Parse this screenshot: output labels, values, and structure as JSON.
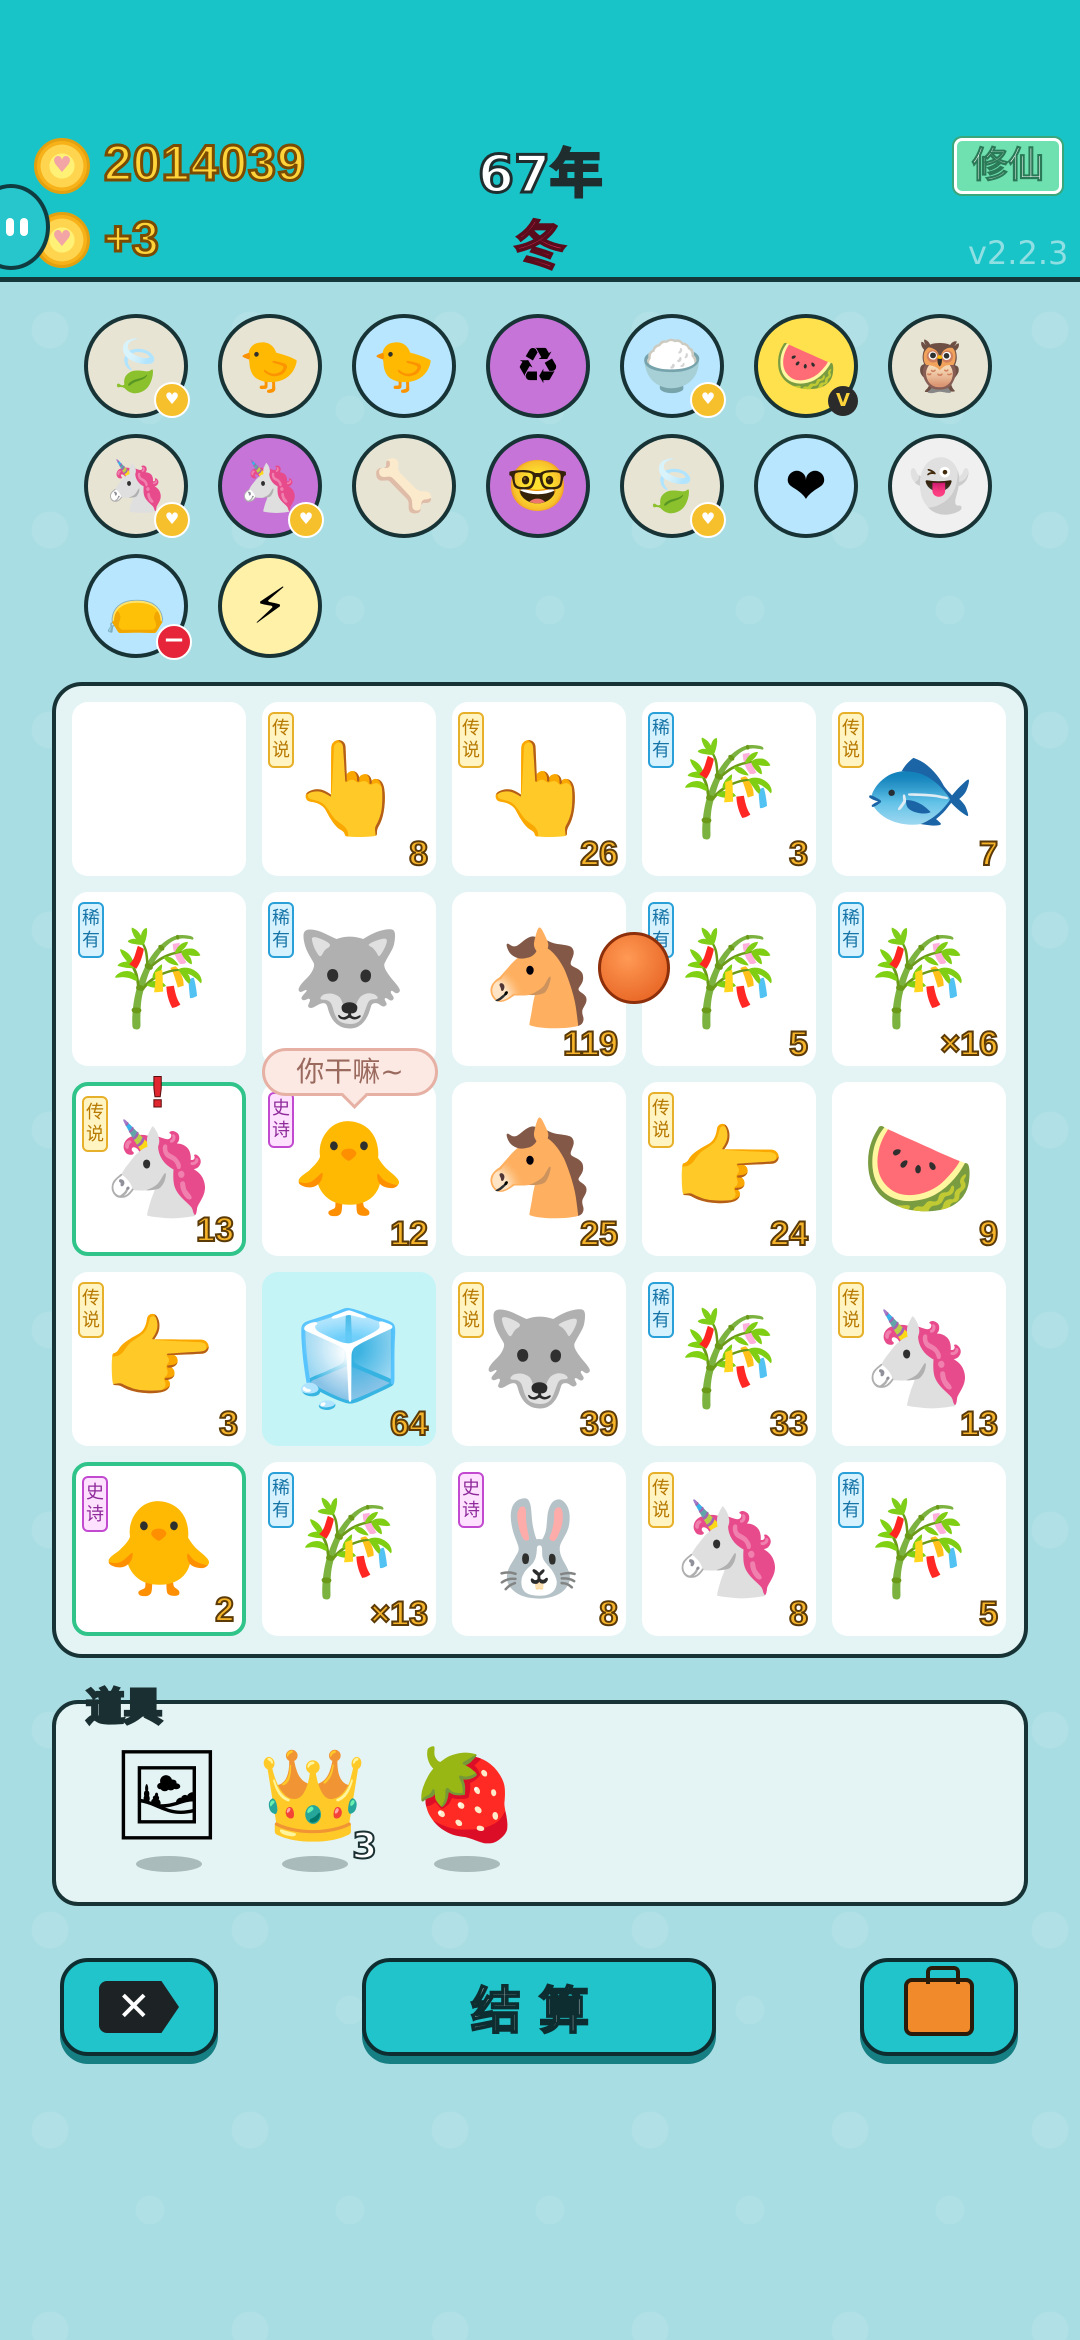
{
  "header": {
    "coins": "2014039",
    "coin_gain": "+3",
    "year": "67年",
    "season": "冬",
    "xiuxian_label": "修仙",
    "version": "v2.2.3"
  },
  "status_icons": [
    {
      "name": "leaf-icon",
      "glyph": "🍃",
      "bg": "#e7e4d4",
      "badge": "heart"
    },
    {
      "name": "chick-egg-icon",
      "glyph": "🐤",
      "bg": "#e7e4d4",
      "badge": ""
    },
    {
      "name": "chick-egg-icon-2",
      "glyph": "🐤",
      "bg": "#b8e6ff",
      "badge": ""
    },
    {
      "name": "recycle-icon",
      "glyph": "♻",
      "bg": "#c774d8",
      "badge": ""
    },
    {
      "name": "rice-bowl-icon",
      "glyph": "🍚",
      "bg": "#b8e6ff",
      "badge": "heart"
    },
    {
      "name": "fruit-basket-icon",
      "glyph": "🍉",
      "bg": "#ffe14d",
      "badge": "v"
    },
    {
      "name": "owl-icon",
      "glyph": "🦉",
      "bg": "#e7e4d4",
      "badge": ""
    },
    {
      "name": "unicorns-icon",
      "glyph": "🦄",
      "bg": "#e7e4d4",
      "badge": "heart"
    },
    {
      "name": "unicorns-icon-2",
      "glyph": "🦄",
      "bg": "#c774d8",
      "badge": "heart"
    },
    {
      "name": "dog-bowl-icon",
      "glyph": "🦴",
      "bg": "#e7e4d4",
      "badge": ""
    },
    {
      "name": "math-head-icon",
      "glyph": "🤓",
      "bg": "#c774d8",
      "badge": ""
    },
    {
      "name": "leaf-icon-2",
      "glyph": "🍃",
      "bg": "#e7e4d4",
      "badge": "heart"
    },
    {
      "name": "heart-potion-icon",
      "glyph": "❤",
      "bg": "#b8e6ff",
      "badge": ""
    },
    {
      "name": "ghost-icon",
      "glyph": "👻",
      "bg": "#f0f0f0",
      "badge": ""
    },
    {
      "name": "trash-bag-icon",
      "glyph": "👝",
      "bg": "#b8e6ff",
      "badge": "minus"
    },
    {
      "name": "lightning-icon",
      "glyph": "⚡",
      "bg": "#fff1a8",
      "badge": ""
    }
  ],
  "tiles": [
    {
      "name": "empty",
      "glyph": "",
      "tag": "",
      "count": ""
    },
    {
      "name": "finger",
      "glyph": "👆",
      "tag": "传说",
      "tagtype": "legend",
      "count": "8"
    },
    {
      "name": "finger",
      "glyph": "👆",
      "tag": "传说",
      "tagtype": "legend",
      "count": "26"
    },
    {
      "name": "bamboo",
      "glyph": "🎋",
      "tag": "稀有",
      "tagtype": "rare",
      "count": "3"
    },
    {
      "name": "koi",
      "glyph": "🐟",
      "tag": "传说",
      "tagtype": "legend",
      "count": "7"
    },
    {
      "name": "bamboo",
      "glyph": "🎋",
      "tag": "稀有",
      "tagtype": "rare",
      "count": ""
    },
    {
      "name": "husky",
      "glyph": "🐺",
      "tag": "稀有",
      "tagtype": "rare",
      "count": ""
    },
    {
      "name": "horse",
      "glyph": "🐴",
      "tag": "",
      "count": "119"
    },
    {
      "name": "bamboo",
      "glyph": "🎋",
      "tag": "稀有",
      "tagtype": "rare",
      "count": "5"
    },
    {
      "name": "bamboo",
      "glyph": "🎋",
      "tag": "稀有",
      "tagtype": "rare",
      "count": "×16"
    },
    {
      "name": "unicorn",
      "glyph": "🦄",
      "tag": "传说",
      "tagtype": "legend",
      "count": "13",
      "sel": true
    },
    {
      "name": "grandpa-bird",
      "glyph": "🐥",
      "tag": "史诗",
      "tagtype": "epic",
      "count": "12"
    },
    {
      "name": "horse",
      "glyph": "🐴",
      "tag": "",
      "count": "25"
    },
    {
      "name": "finger-point",
      "glyph": "👉",
      "tag": "传说",
      "tagtype": "legend",
      "count": "24"
    },
    {
      "name": "watermelon",
      "glyph": "🍉",
      "tag": "",
      "count": "9"
    },
    {
      "name": "finger-point",
      "glyph": "👉",
      "tag": "传说",
      "tagtype": "legend",
      "count": "3"
    },
    {
      "name": "fridge",
      "glyph": "🧊",
      "tag": "",
      "count": "64",
      "teal": true
    },
    {
      "name": "king-husky",
      "glyph": "🐺",
      "tag": "传说",
      "tagtype": "legend",
      "count": "39"
    },
    {
      "name": "bamboo",
      "glyph": "🎋",
      "tag": "稀有",
      "tagtype": "rare",
      "count": "33"
    },
    {
      "name": "unicorn",
      "glyph": "🦄",
      "tag": "传说",
      "tagtype": "legend",
      "count": "13"
    },
    {
      "name": "grandpa-bird",
      "glyph": "🐥",
      "tag": "史诗",
      "tagtype": "epic",
      "count": "2",
      "sel": true
    },
    {
      "name": "bamboo",
      "glyph": "🎋",
      "tag": "稀有",
      "tagtype": "rare",
      "count": "×13"
    },
    {
      "name": "bunny-house",
      "glyph": "🐰",
      "tag": "史诗",
      "tagtype": "epic",
      "count": "8"
    },
    {
      "name": "unicorn",
      "glyph": "🦄",
      "tag": "传说",
      "tagtype": "legend",
      "count": "8"
    },
    {
      "name": "bamboo",
      "glyph": "🎋",
      "tag": "稀有",
      "tagtype": "rare",
      "count": "5"
    }
  ],
  "speech_bubble": "你干嘛~",
  "items": {
    "title": "道具",
    "list": [
      {
        "name": "frame-item",
        "glyph": "🖼"
      },
      {
        "name": "crown-item",
        "glyph": "👑"
      },
      {
        "name": "strawberry-item",
        "glyph": "🍓"
      }
    ],
    "crown_count": "3"
  },
  "buttons": {
    "close_icon": "✕",
    "settle_label": "结算",
    "bag_icon": "briefcase-icon"
  }
}
